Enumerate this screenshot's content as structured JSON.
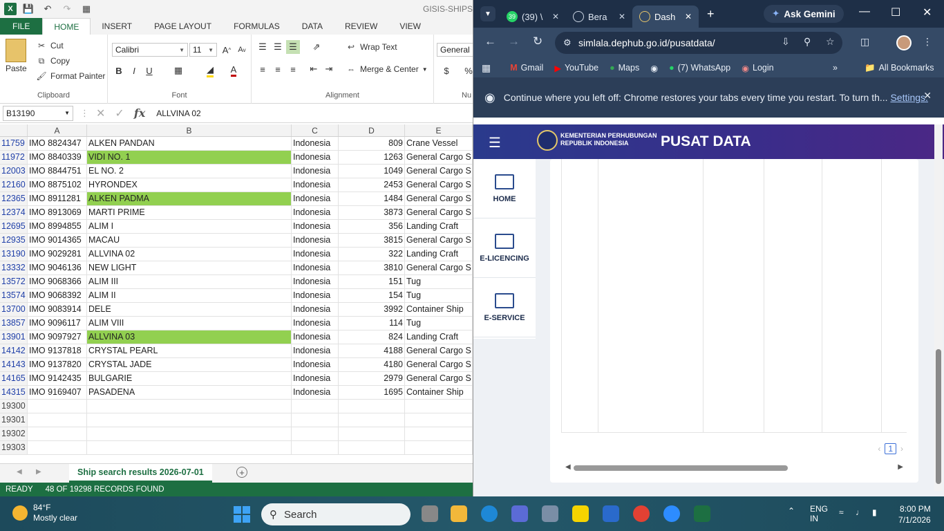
{
  "excel": {
    "title_text": "GISIS-SHIPS-",
    "tabs": [
      "FILE",
      "HOME",
      "INSERT",
      "PAGE LAYOUT",
      "FORMULAS",
      "DATA",
      "REVIEW",
      "VIEW"
    ],
    "clipboard": {
      "paste": "Paste",
      "cut": "Cut",
      "copy": "Copy",
      "format_painter": "Format Painter",
      "group": "Clipboard"
    },
    "font": {
      "name": "Calibri",
      "size": "11",
      "group": "Font"
    },
    "alignment": {
      "wrap_text": "Wrap Text",
      "merge_center": "Merge & Center",
      "group": "Alignment"
    },
    "number": {
      "format": "General",
      "group": "Nu"
    },
    "name_box": "B13190",
    "formula_value": "ALLVINA 02",
    "columns": [
      "A",
      "B",
      "C",
      "D",
      "E"
    ],
    "rows": [
      {
        "n": "11759",
        "a": "IMO 8824347",
        "b": "ALKEN PANDAN",
        "c": "Indonesia",
        "d": "809",
        "e": "Crane Vessel",
        "hl": false
      },
      {
        "n": "11972",
        "a": "IMO 8840339",
        "b": "VIDI NO. 1",
        "c": "Indonesia",
        "d": "1263",
        "e": "General Cargo S",
        "hl": true
      },
      {
        "n": "12003",
        "a": "IMO 8844751",
        "b": "EL NO. 2",
        "c": "Indonesia",
        "d": "1049",
        "e": "General Cargo S",
        "hl": false
      },
      {
        "n": "12160",
        "a": "IMO 8875102",
        "b": "HYRONDEX",
        "c": "Indonesia",
        "d": "2453",
        "e": "General Cargo S",
        "hl": false
      },
      {
        "n": "12365",
        "a": "IMO 8911281",
        "b": "ALKEN PADMA",
        "c": "Indonesia",
        "d": "1484",
        "e": "General Cargo S",
        "hl": true
      },
      {
        "n": "12374",
        "a": "IMO 8913069",
        "b": "MARTI PRIME",
        "c": "Indonesia",
        "d": "3873",
        "e": "General Cargo S",
        "hl": false
      },
      {
        "n": "12695",
        "a": "IMO 8994855",
        "b": "ALIM I",
        "c": "Indonesia",
        "d": "356",
        "e": "Landing Craft",
        "hl": false
      },
      {
        "n": "12935",
        "a": "IMO 9014365",
        "b": "MACAU",
        "c": "Indonesia",
        "d": "3815",
        "e": "General Cargo S",
        "hl": false
      },
      {
        "n": "13190",
        "a": "IMO 9029281",
        "b": "ALLVINA 02",
        "c": "Indonesia",
        "d": "322",
        "e": "Landing Craft",
        "hl": false
      },
      {
        "n": "13332",
        "a": "IMO 9046136",
        "b": "NEW LIGHT",
        "c": "Indonesia",
        "d": "3810",
        "e": "General Cargo S",
        "hl": false
      },
      {
        "n": "13572",
        "a": "IMO 9068366",
        "b": "ALIM III",
        "c": "Indonesia",
        "d": "151",
        "e": "Tug",
        "hl": false
      },
      {
        "n": "13574",
        "a": "IMO 9068392",
        "b": "ALIM II",
        "c": "Indonesia",
        "d": "154",
        "e": "Tug",
        "hl": false
      },
      {
        "n": "13700",
        "a": "IMO 9083914",
        "b": "DELE",
        "c": "Indonesia",
        "d": "3992",
        "e": "Container Ship",
        "hl": false
      },
      {
        "n": "13857",
        "a": "IMO 9096117",
        "b": "ALIM VIII",
        "c": "Indonesia",
        "d": "114",
        "e": "Tug",
        "hl": false
      },
      {
        "n": "13901",
        "a": "IMO 9097927",
        "b": "ALLVINA 03",
        "c": "Indonesia",
        "d": "824",
        "e": "Landing Craft",
        "hl": true
      },
      {
        "n": "14142",
        "a": "IMO 9137818",
        "b": "CRYSTAL PEARL",
        "c": "Indonesia",
        "d": "4188",
        "e": "General Cargo S",
        "hl": false
      },
      {
        "n": "14143",
        "a": "IMO 9137820",
        "b": "CRYSTAL JADE",
        "c": "Indonesia",
        "d": "4180",
        "e": "General Cargo S",
        "hl": false
      },
      {
        "n": "14165",
        "a": "IMO 9142435",
        "b": "BULGARIE",
        "c": "Indonesia",
        "d": "2979",
        "e": "General Cargo S",
        "hl": false
      },
      {
        "n": "14315",
        "a": "IMO 9169407",
        "b": "PASADENA",
        "c": "Indonesia",
        "d": "1695",
        "e": "Container Ship",
        "hl": false
      }
    ],
    "empty_rows": [
      "19300",
      "19301",
      "19302",
      "19303"
    ],
    "sheet_tab": "Ship search results 2026-07-01",
    "status_ready": "READY",
    "status_records": "48 OF 19298 RECORDS FOUND",
    "green": "#1d6f42",
    "highlight": "#92d050"
  },
  "chrome": {
    "tabs": [
      {
        "label": "(39) \\",
        "icon": "whatsapp-icon"
      },
      {
        "label": "Bera",
        "icon": "globe-icon"
      },
      {
        "label": "Dash",
        "icon": "globe-icon"
      }
    ],
    "ask_gemini": "Ask Gemini",
    "url": "simlala.dephub.go.id/pusatdata/",
    "bookmarks": [
      "Gmail",
      "YouTube",
      "Maps",
      "(7) WhatsApp",
      "Login"
    ],
    "all_bookmarks": "All Bookmarks",
    "restore_msg": "Continue where you left off: Chrome restores your tabs every time you restart. To turn th...",
    "restore_link": "Settings.",
    "site": {
      "ministry_line1": "KEMENTERIAN PERHUBUNGAN",
      "ministry_line2": "REPUBLIK INDONESIA",
      "title": "PUSAT DATA",
      "menu": [
        "HOME",
        "E-LICENCING",
        "E-SERVICE"
      ],
      "page": "1"
    }
  },
  "taskbar": {
    "temp": "84°F",
    "weather": "Mostly clear",
    "search": "Search",
    "lang1": "ENG",
    "lang2": "IN",
    "time": "8:00 PM",
    "date": "7/1/2026"
  }
}
